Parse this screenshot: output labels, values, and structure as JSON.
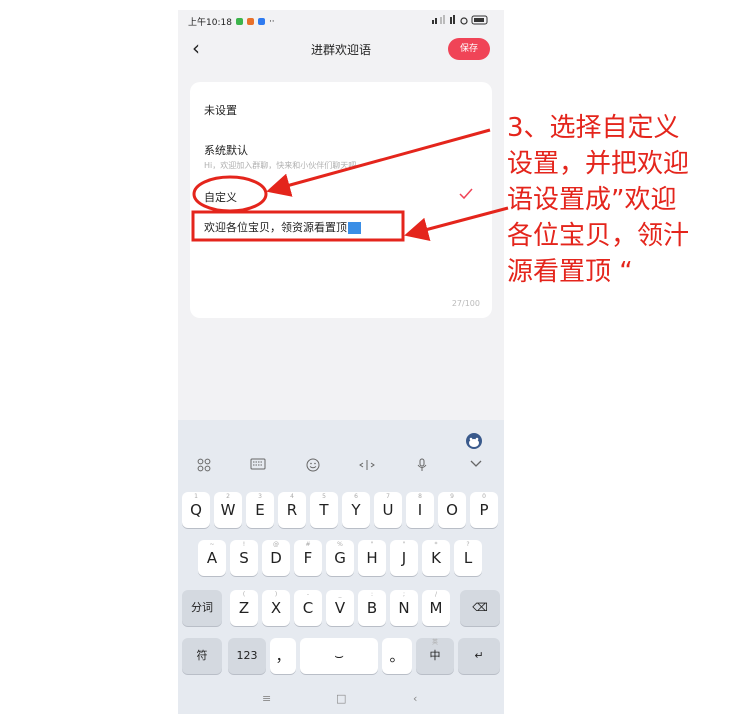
{
  "status_bar": {
    "time": "上午10:18",
    "more": "··"
  },
  "nav": {
    "back_glyph": "‹",
    "title": "进群欢迎语",
    "save_label": "保存"
  },
  "options": [
    {
      "label": "未设置"
    },
    {
      "label": "系统默认",
      "desc": "Hi，欢迎加入群聊，快来和小伙伴们聊天吧"
    },
    {
      "label": "自定义",
      "selected": true
    }
  ],
  "custom_input": {
    "value": "欢迎各位宝贝，领资源看置顶",
    "counter": "27/100"
  },
  "keyboard": {
    "toolbar_icons": [
      "grid-icon",
      "keyboard-icon",
      "emoji-icon",
      "cursor-move-icon",
      "mic-icon",
      "chevron-down-icon"
    ],
    "row1": [
      {
        "k": "Q",
        "s": "1"
      },
      {
        "k": "W",
        "s": "2"
      },
      {
        "k": "E",
        "s": "3"
      },
      {
        "k": "R",
        "s": "4"
      },
      {
        "k": "T",
        "s": "5"
      },
      {
        "k": "Y",
        "s": "6"
      },
      {
        "k": "U",
        "s": "7"
      },
      {
        "k": "I",
        "s": "8"
      },
      {
        "k": "O",
        "s": "9"
      },
      {
        "k": "P",
        "s": "0"
      }
    ],
    "row2": [
      {
        "k": "A",
        "s": "~"
      },
      {
        "k": "S",
        "s": "!"
      },
      {
        "k": "D",
        "s": "@"
      },
      {
        "k": "F",
        "s": "#"
      },
      {
        "k": "G",
        "s": "%"
      },
      {
        "k": "H",
        "s": "\""
      },
      {
        "k": "J",
        "s": "\""
      },
      {
        "k": "K",
        "s": "*"
      },
      {
        "k": "L",
        "s": "?"
      }
    ],
    "row3": [
      {
        "k": "Z",
        "s": "("
      },
      {
        "k": "X",
        "s": ")"
      },
      {
        "k": "C",
        "s": "-"
      },
      {
        "k": "V",
        "s": "_"
      },
      {
        "k": "B",
        "s": ":"
      },
      {
        "k": "N",
        "s": ";"
      },
      {
        "k": "M",
        "s": "/"
      }
    ],
    "fenci_label": "分词",
    "fu_label": "符",
    "num_label": "123",
    "comma": "，",
    "period": "。",
    "zh_label": "中",
    "zh_sub": "英",
    "enter_glyph": "↵",
    "backspace_glyph": "⌫",
    "space_glyph": "⌣"
  },
  "system_nav": {
    "menu": "≡",
    "home": "□",
    "back": "‹"
  },
  "annotation": {
    "lines": [
      "3、选择自定义",
      "设置，并把欢迎",
      "语设置成”欢迎",
      "各位宝贝，领汁",
      "源看置顶 “"
    ]
  },
  "colors": {
    "accent": "#f04457",
    "annotation_red": "#e4251c",
    "keyboard_bg": "#e6eaf0"
  }
}
